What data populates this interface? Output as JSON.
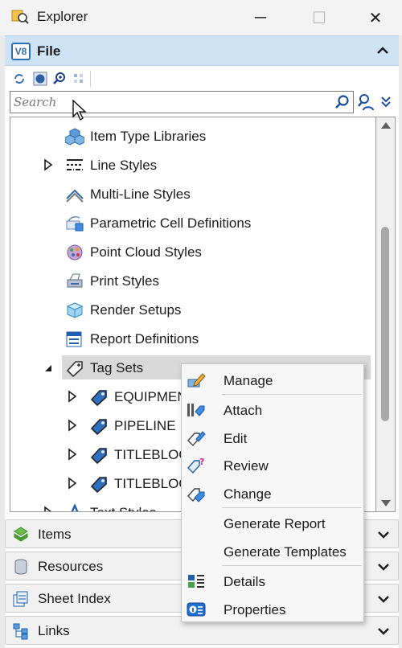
{
  "window": {
    "title": "Explorer",
    "minimize_glyph": "─",
    "maximize_glyph": "☐",
    "close_glyph": "✕"
  },
  "file_section": {
    "badge": "V8",
    "label": "File"
  },
  "search": {
    "placeholder": "Search",
    "value": ""
  },
  "tree": {
    "items": [
      {
        "label": "Item Type Libraries",
        "icon": "item-type-icon",
        "expander": "none"
      },
      {
        "label": "Line Styles",
        "icon": "line-style-icon",
        "expander": "collapsed"
      },
      {
        "label": "Multi-Line Styles",
        "icon": "multiline-style-icon",
        "expander": "none"
      },
      {
        "label": "Parametric Cell Definitions",
        "icon": "parametric-cell-icon",
        "expander": "none"
      },
      {
        "label": "Point Cloud Styles",
        "icon": "point-cloud-icon",
        "expander": "none"
      },
      {
        "label": "Print Styles",
        "icon": "print-style-icon",
        "expander": "none"
      },
      {
        "label": "Render Setups",
        "icon": "render-setup-icon",
        "expander": "none"
      },
      {
        "label": "Report Definitions",
        "icon": "report-definition-icon",
        "expander": "none"
      },
      {
        "label": "Tag Sets",
        "icon": "tag-icon",
        "expander": "expanded"
      },
      {
        "label": "EQUIPMENT",
        "icon": "tag-icon",
        "expander": "collapsed"
      },
      {
        "label": "PIPELINE",
        "icon": "tag-icon",
        "expander": "collapsed"
      },
      {
        "label": "TITLEBLOCK",
        "icon": "tag-icon",
        "expander": "collapsed"
      },
      {
        "label": "TITLEBLOCK",
        "icon": "tag-icon",
        "expander": "collapsed"
      },
      {
        "label": "Text Styles",
        "icon": "text-style-icon",
        "expander": "collapsed"
      }
    ]
  },
  "panels": {
    "items": "Items",
    "resources": "Resources",
    "sheet_index": "Sheet Index",
    "links": "Links"
  },
  "context_menu": {
    "manage": "Manage",
    "attach": "Attach",
    "edit": "Edit",
    "review": "Review",
    "change": "Change",
    "generate_report": "Generate Report",
    "generate_templates": "Generate Templates",
    "details": "Details",
    "properties": "Properties"
  },
  "colors": {
    "accent_blue": "#2c6fb5",
    "file_header_bg": "#cfe3f7",
    "selection_bg": "#d9d9d9"
  }
}
